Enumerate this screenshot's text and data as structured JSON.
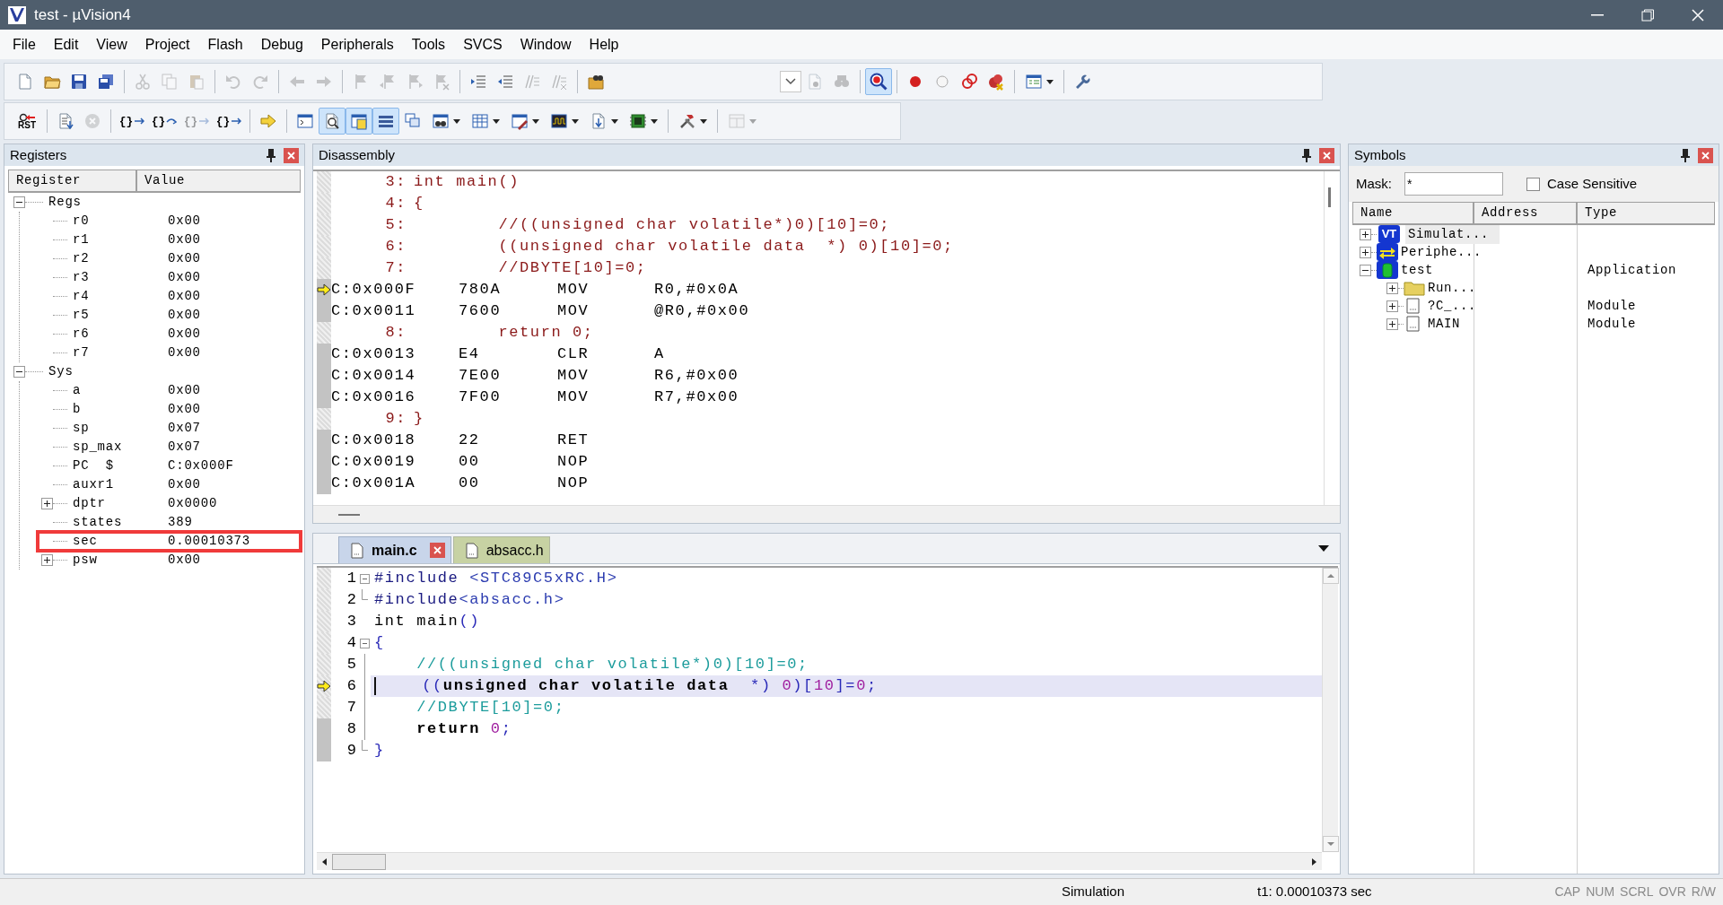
{
  "window": {
    "title": "test  - µVision4"
  },
  "menu": [
    "File",
    "Edit",
    "View",
    "Project",
    "Flash",
    "Debug",
    "Peripherals",
    "Tools",
    "SVCS",
    "Window",
    "Help"
  ],
  "toolbars": [
    [
      {
        "kind": "button",
        "disabled": false,
        "pressed": false,
        "dropdown": false
      },
      {
        "kind": "button",
        "disabled": false,
        "pressed": false,
        "dropdown": false
      },
      {
        "kind": "button",
        "disabled": false,
        "pressed": false,
        "dropdown": false
      },
      {
        "kind": "button",
        "disabled": false,
        "pressed": false,
        "dropdown": false
      },
      {
        "kind": "separator"
      },
      {
        "kind": "button",
        "disabled": true,
        "pressed": false,
        "dropdown": false
      },
      {
        "kind": "button",
        "disabled": true,
        "pressed": false,
        "dropdown": false
      },
      {
        "kind": "button",
        "disabled": true,
        "pressed": false,
        "dropdown": false
      },
      {
        "kind": "separator"
      },
      {
        "kind": "button",
        "disabled": true,
        "pressed": false,
        "dropdown": false
      },
      {
        "kind": "button",
        "disabled": true,
        "pressed": false,
        "dropdown": false
      },
      {
        "kind": "separator"
      },
      {
        "kind": "button",
        "disabled": true,
        "pressed": false,
        "dropdown": false
      },
      {
        "kind": "button",
        "disabled": true,
        "pressed": false,
        "dropdown": false
      },
      {
        "kind": "separator"
      },
      {
        "kind": "button",
        "disabled": true,
        "pressed": false,
        "dropdown": false
      },
      {
        "kind": "button",
        "disabled": true,
        "pressed": false,
        "dropdown": false
      },
      {
        "kind": "button",
        "disabled": true,
        "pressed": false,
        "dropdown": false
      },
      {
        "kind": "button",
        "disabled": true,
        "pressed": false,
        "dropdown": false
      },
      {
        "kind": "separator"
      },
      {
        "kind": "button",
        "disabled": false,
        "pressed": false,
        "dropdown": false
      },
      {
        "kind": "button",
        "disabled": false,
        "pressed": false,
        "dropdown": false
      },
      {
        "kind": "button",
        "disabled": true,
        "pressed": false,
        "dropdown": false
      },
      {
        "kind": "button",
        "disabled": true,
        "pressed": false,
        "dropdown": false
      },
      {
        "kind": "separator"
      },
      {
        "kind": "button",
        "disabled": false,
        "pressed": false,
        "dropdown": false
      },
      {
        "kind": "spacer"
      },
      {
        "kind": "combo"
      },
      {
        "kind": "button",
        "disabled": true,
        "pressed": false,
        "dropdown": false
      },
      {
        "kind": "button",
        "disabled": true,
        "pressed": false,
        "dropdown": false
      },
      {
        "kind": "separator"
      },
      {
        "kind": "button",
        "disabled": false,
        "pressed": true,
        "dropdown": false
      },
      {
        "kind": "separator"
      },
      {
        "kind": "button",
        "disabled": false,
        "pressed": false,
        "dropdown": false
      },
      {
        "kind": "button",
        "disabled": false,
        "pressed": false,
        "dropdown": false
      },
      {
        "kind": "button",
        "disabled": false,
        "pressed": false,
        "dropdown": false
      },
      {
        "kind": "button",
        "disabled": false,
        "pressed": false,
        "dropdown": false
      },
      {
        "kind": "separator"
      },
      {
        "kind": "button",
        "disabled": false,
        "pressed": false,
        "dropdown": true
      },
      {
        "kind": "separator"
      },
      {
        "kind": "button",
        "disabled": false,
        "pressed": false,
        "dropdown": false
      }
    ],
    [
      {
        "kind": "button",
        "disabled": false,
        "pressed": false,
        "dropdown": false,
        "label": "RST"
      },
      {
        "kind": "separator"
      },
      {
        "kind": "button",
        "disabled": false,
        "pressed": false,
        "dropdown": false
      },
      {
        "kind": "button",
        "disabled": true,
        "pressed": false,
        "dropdown": false
      },
      {
        "kind": "separator"
      },
      {
        "kind": "button",
        "disabled": false,
        "pressed": false,
        "dropdown": false,
        "label": "{}"
      },
      {
        "kind": "button",
        "disabled": false,
        "pressed": false,
        "dropdown": false,
        "label": "{}"
      },
      {
        "kind": "button",
        "disabled": true,
        "pressed": false,
        "dropdown": false,
        "label": "{}"
      },
      {
        "kind": "button",
        "disabled": false,
        "pressed": false,
        "dropdown": false,
        "label": "{}"
      },
      {
        "kind": "separator"
      },
      {
        "kind": "button",
        "disabled": false,
        "pressed": false,
        "dropdown": false
      },
      {
        "kind": "separator"
      },
      {
        "kind": "button",
        "disabled": false,
        "pressed": false,
        "dropdown": false
      },
      {
        "kind": "button",
        "disabled": false,
        "pressed": true,
        "dropdown": false
      },
      {
        "kind": "button",
        "disabled": false,
        "pressed": true,
        "dropdown": false
      },
      {
        "kind": "button",
        "disabled": false,
        "pressed": true,
        "dropdown": false
      },
      {
        "kind": "button",
        "disabled": false,
        "pressed": false,
        "dropdown": false
      },
      {
        "kind": "button",
        "disabled": false,
        "pressed": false,
        "dropdown": true
      },
      {
        "kind": "button",
        "disabled": false,
        "pressed": false,
        "dropdown": true
      },
      {
        "kind": "button",
        "disabled": false,
        "pressed": false,
        "dropdown": true
      },
      {
        "kind": "button",
        "disabled": false,
        "pressed": false,
        "dropdown": true
      },
      {
        "kind": "button",
        "disabled": false,
        "pressed": false,
        "dropdown": true
      },
      {
        "kind": "button",
        "disabled": false,
        "pressed": false,
        "dropdown": true
      },
      {
        "kind": "separator"
      },
      {
        "kind": "button",
        "disabled": false,
        "pressed": false,
        "dropdown": true
      },
      {
        "kind": "separator"
      },
      {
        "kind": "button",
        "disabled": true,
        "pressed": false,
        "dropdown": true
      }
    ]
  ],
  "registers": {
    "title": "Registers",
    "columns": [
      "Register",
      "Value"
    ],
    "items": [
      {
        "name": "Regs",
        "value": "",
        "expanded": true,
        "boxed": false,
        "children": [
          {
            "name": "r0",
            "value": "0x00",
            "boxed": false
          },
          {
            "name": "r1",
            "value": "0x00",
            "boxed": false
          },
          {
            "name": "r2",
            "value": "0x00",
            "boxed": false
          },
          {
            "name": "r3",
            "value": "0x00",
            "boxed": false
          },
          {
            "name": "r4",
            "value": "0x00",
            "boxed": false
          },
          {
            "name": "r5",
            "value": "0x00",
            "boxed": false
          },
          {
            "name": "r6",
            "value": "0x00",
            "boxed": false
          },
          {
            "name": "r7",
            "value": "0x00",
            "boxed": false
          }
        ]
      },
      {
        "name": "Sys",
        "value": "",
        "expanded": true,
        "boxed": false,
        "children": [
          {
            "name": "a",
            "value": "0x00",
            "boxed": false
          },
          {
            "name": "b",
            "value": "0x00",
            "boxed": false
          },
          {
            "name": "sp",
            "value": "0x07",
            "boxed": false
          },
          {
            "name": "sp_max",
            "value": "0x07",
            "boxed": false
          },
          {
            "name": "PC  $",
            "value": "C:0x000F",
            "boxed": false
          },
          {
            "name": "auxr1",
            "value": "0x00",
            "boxed": false
          },
          {
            "name": "dptr",
            "value": "0x0000",
            "expanded": false,
            "boxed": false
          },
          {
            "name": "states",
            "value": "389",
            "boxed": false
          },
          {
            "name": "sec",
            "value": "0.00010373",
            "boxed": true
          },
          {
            "name": "psw",
            "value": "0x00",
            "expanded": false,
            "boxed": false
          }
        ]
      }
    ]
  },
  "disassembly": {
    "title": "Disassembly",
    "lines": [
      {
        "kind": "source",
        "number": "3:",
        "text": "int main()"
      },
      {
        "kind": "source",
        "number": "4:",
        "text": "{"
      },
      {
        "kind": "source",
        "number": "5:",
        "text": "\t//((unsigned char volatile*)0)[10]=0;"
      },
      {
        "kind": "source",
        "number": "6:",
        "text": "\t((unsigned char volatile data  *) 0)[10]=0;"
      },
      {
        "kind": "source",
        "number": "7:",
        "text": "\t//DBYTE[10]=0;"
      },
      {
        "kind": "asm",
        "address": "C:0x000F",
        "opcode": "780A",
        "mnemonic": "MOV",
        "operands": "R0,#0x0A",
        "current": true
      },
      {
        "kind": "asm",
        "address": "C:0x0011",
        "opcode": "7600",
        "mnemonic": "MOV",
        "operands": "@R0,#0x00",
        "current": false
      },
      {
        "kind": "source",
        "number": "8:",
        "text": "\treturn 0;"
      },
      {
        "kind": "asm",
        "address": "C:0x0013",
        "opcode": "E4",
        "mnemonic": "CLR",
        "operands": "A",
        "current": false
      },
      {
        "kind": "asm",
        "address": "C:0x0014",
        "opcode": "7E00",
        "mnemonic": "MOV",
        "operands": "R6,#0x00",
        "current": false
      },
      {
        "kind": "asm",
        "address": "C:0x0016",
        "opcode": "7F00",
        "mnemonic": "MOV",
        "operands": "R7,#0x00",
        "current": false
      },
      {
        "kind": "source",
        "number": "9:",
        "text": "}"
      },
      {
        "kind": "asm",
        "address": "C:0x0018",
        "opcode": "22",
        "mnemonic": "RET",
        "current": false
      },
      {
        "kind": "asm",
        "address": "C:0x0019",
        "opcode": "00",
        "mnemonic": "NOP",
        "current": false
      },
      {
        "kind": "asm",
        "address": "C:0x001A",
        "opcode": "00",
        "mnemonic": "NOP",
        "current": false
      }
    ]
  },
  "editor": {
    "tabs": [
      {
        "label": "main.c",
        "selected": true,
        "closable": true
      },
      {
        "label": "absacc.h",
        "selected": false,
        "closable": false
      }
    ],
    "lines": [
      {
        "number": "1",
        "fold_toggle": true,
        "fold_end": false,
        "in_fold": false,
        "executable": false,
        "current": false,
        "tokens": [
          {
            "kind": "preproc",
            "text": "#include"
          },
          {
            "kind": "header",
            "text": " <STC89C5xRC.H>"
          }
        ]
      },
      {
        "number": "2",
        "fold_toggle": false,
        "fold_end": true,
        "in_fold": false,
        "executable": false,
        "current": false,
        "tokens": [
          {
            "kind": "preproc",
            "text": "#include"
          },
          {
            "kind": "header",
            "text": "<absacc.h>"
          }
        ]
      },
      {
        "number": "3",
        "fold_toggle": false,
        "fold_end": false,
        "in_fold": false,
        "executable": false,
        "current": false,
        "tokens": [
          {
            "kind": "plain",
            "text": "int main"
          },
          {
            "kind": "op",
            "text": "()"
          }
        ]
      },
      {
        "number": "4",
        "fold_toggle": true,
        "fold_end": false,
        "in_fold": false,
        "executable": false,
        "current": false,
        "tokens": [
          {
            "kind": "op",
            "text": "{"
          }
        ]
      },
      {
        "number": "5",
        "fold_toggle": false,
        "fold_end": false,
        "in_fold": true,
        "executable": false,
        "current": false,
        "tokens": [
          {
            "kind": "comment",
            "text": "\t//((unsigned char volatile*)0)[10]=0;"
          }
        ]
      },
      {
        "number": "6",
        "fold_toggle": false,
        "fold_end": false,
        "in_fold": true,
        "executable": false,
        "current": true,
        "tokens": [
          {
            "kind": "op",
            "text": "\t(("
          },
          {
            "kind": "keyword",
            "text": "unsigned char volatile data"
          },
          {
            "kind": "op",
            "text": "  *) "
          },
          {
            "kind": "number",
            "text": "0"
          },
          {
            "kind": "op",
            "text": ")["
          },
          {
            "kind": "number",
            "text": "10"
          },
          {
            "kind": "op",
            "text": "]="
          },
          {
            "kind": "number",
            "text": "0"
          },
          {
            "kind": "op",
            "text": ";"
          }
        ]
      },
      {
        "number": "7",
        "fold_toggle": false,
        "fold_end": false,
        "in_fold": true,
        "executable": false,
        "current": false,
        "tokens": [
          {
            "kind": "comment",
            "text": "\t//DBYTE[10]=0;"
          }
        ]
      },
      {
        "number": "8",
        "fold_toggle": false,
        "fold_end": false,
        "in_fold": true,
        "executable": true,
        "current": false,
        "tokens": [
          {
            "kind": "keyword",
            "text": "\treturn"
          },
          {
            "kind": "number",
            "text": " 0"
          },
          {
            "kind": "op",
            "text": ";"
          }
        ]
      },
      {
        "number": "9",
        "fold_toggle": false,
        "fold_end": true,
        "in_fold": false,
        "executable": true,
        "current": false,
        "tokens": [
          {
            "kind": "op",
            "text": "}"
          }
        ]
      }
    ]
  },
  "symbols": {
    "title": "Symbols",
    "mask_label": "Mask:",
    "mask": "*",
    "case_sensitive": {
      "label": "Case Sensitive",
      "checked": false
    },
    "columns": [
      "Name",
      "Address",
      "Type"
    ],
    "items": [
      {
        "kind": "vt",
        "badge": "VT",
        "name": "Simulat...",
        "expanded": false,
        "selected": true
      },
      {
        "kind": "peripheral",
        "name": "Periphe...",
        "expanded": false,
        "selected": false
      },
      {
        "kind": "application",
        "name": "test",
        "type": "Application",
        "expanded": true,
        "selected": false,
        "children": [
          {
            "kind": "folder",
            "name": "Run...",
            "expanded": false,
            "selected": false
          },
          {
            "kind": "module",
            "name": "?C_...",
            "type": "Module",
            "expanded": false,
            "selected": false
          },
          {
            "kind": "module",
            "name": "MAIN",
            "type": "Module",
            "expanded": false,
            "selected": false
          }
        ]
      }
    ]
  },
  "status_bar": {
    "mode": "Simulation",
    "time": "t1: 0.00010373 sec",
    "indicators": [
      {
        "label": "CAP",
        "on": false
      },
      {
        "label": "NUM",
        "on": false
      },
      {
        "label": "SCRL",
        "on": false
      },
      {
        "label": "OVR",
        "on": false
      },
      {
        "label": "R/W",
        "on": false
      }
    ]
  }
}
